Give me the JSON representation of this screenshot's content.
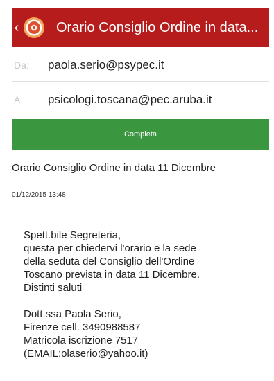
{
  "header": {
    "back_symbol": "‹",
    "title": "Orario Consiglio Ordine in data...",
    "color": "#b71c1c"
  },
  "from": {
    "label": "Da:",
    "value": "paola.serio@psypec.it"
  },
  "to": {
    "label": "A:",
    "value": "psicologi.toscana@pec.aruba.it"
  },
  "status": {
    "label": "Completa",
    "color": "#3b9640"
  },
  "message": {
    "subject": "Orario Consiglio Ordine in data 11 Dicembre",
    "datetime": "01/12/2015  13:48",
    "paragraph1": [
      "Spett.bile Segreteria,",
      "questa per chiedervi l'orario e la sede",
      "della seduta del Consiglio dell'Ordine",
      "Toscano prevista in data 11 Dicembre.",
      "Distinti saluti"
    ],
    "paragraph2": [
      "Dott.ssa Paola Serio,",
      "Firenze cell. 3490988587",
      "Matricola iscrizione 7517",
      "(EMAIL:olaserio@yahoo.it)"
    ]
  }
}
